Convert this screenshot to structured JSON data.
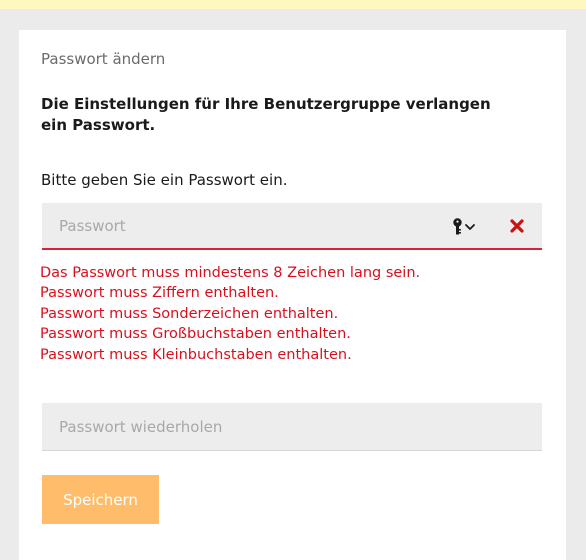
{
  "dialog": {
    "title": "Passwort ändern",
    "headline": "Die Einstellungen für Ihre Benutzergruppe verlangen ein Passwort.",
    "instruction": "Bitte geben Sie ein Passwort ein."
  },
  "password_field": {
    "placeholder": "Passwort",
    "value": "",
    "key_icon": "key-icon",
    "dropdown_icon": "chevron-down-icon",
    "clear_icon": "close-icon"
  },
  "errors": [
    "Das Passwort muss mindestens 8 Zeichen lang sein.",
    "Passwort muss Ziffern enthalten.",
    "Passwort muss Sonderzeichen enthalten.",
    "Passwort muss Großbuchstaben enthalten.",
    "Passwort muss Kleinbuchstaben enthalten."
  ],
  "repeat_field": {
    "placeholder": "Passwort wiederholen",
    "value": ""
  },
  "save_button": {
    "label": "Speichern"
  },
  "colors": {
    "page_background": "#ebebeb",
    "banner": "#fff7c2",
    "error": "#d8101e",
    "field_background": "#ededed",
    "save_button": "#ffbd6b"
  }
}
